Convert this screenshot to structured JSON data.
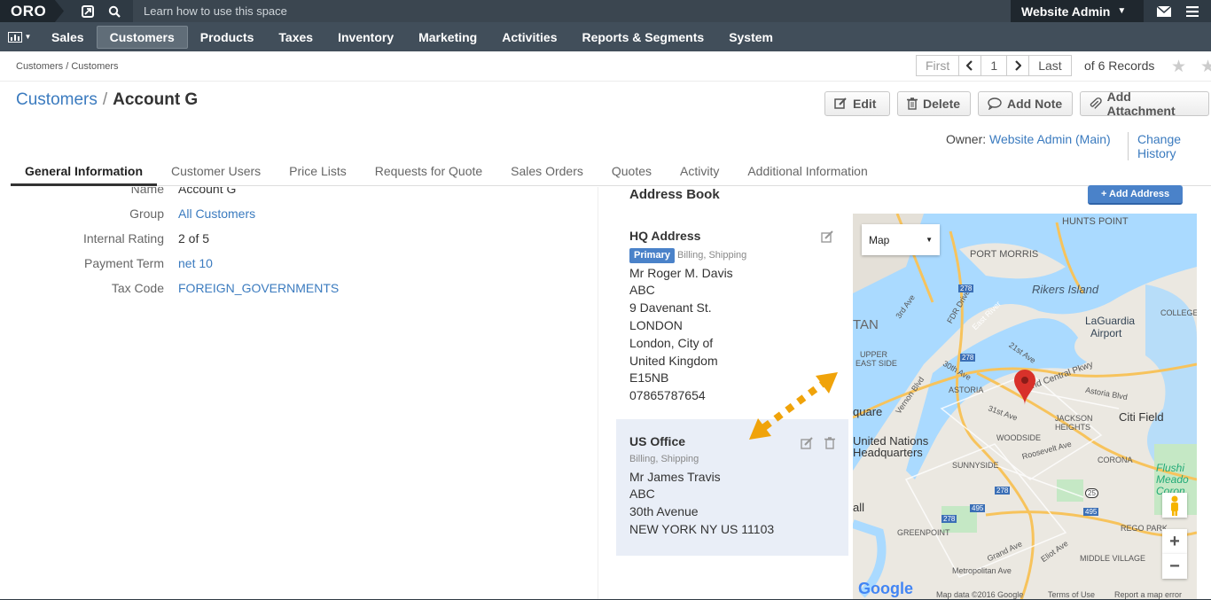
{
  "topbar": {
    "logo": "ORO",
    "search_hint": "Learn how to use this space",
    "user": "Website Admin"
  },
  "nav": [
    "Sales",
    "Customers",
    "Products",
    "Taxes",
    "Inventory",
    "Marketing",
    "Activities",
    "Reports & Segments",
    "System"
  ],
  "breadcrumb": "Customers / Customers",
  "pager": {
    "first": "First",
    "page": "1",
    "last": "Last",
    "records": "of 6 Records"
  },
  "page": {
    "section": "Customers",
    "separator": "/",
    "title": "Account G"
  },
  "actions": {
    "edit": "Edit",
    "delete": "Delete",
    "add_note": "Add Note",
    "add_attachment": "Add Attachment"
  },
  "owner": {
    "label": "Owner:",
    "value": "Website Admin (Main)",
    "change_history": "Change History"
  },
  "tabs": [
    "General Information",
    "Customer Users",
    "Price Lists",
    "Requests for Quote",
    "Sales Orders",
    "Quotes",
    "Activity",
    "Additional Information"
  ],
  "fields": [
    {
      "label": "Name",
      "value": "Account G"
    },
    {
      "label": "Group",
      "value": "All Customers"
    },
    {
      "label": "Internal Rating",
      "value": "2 of 5"
    },
    {
      "label": "Payment Term",
      "value": "net 10"
    },
    {
      "label": "Tax Code",
      "value": "FOREIGN_GOVERNMENTS"
    }
  ],
  "address_book": {
    "title": "Address Book",
    "add_button": "+ Add Address",
    "hq": {
      "title": "HQ Address",
      "primary": "Primary",
      "types": "Billing, Shipping",
      "lines": [
        "Mr Roger M. Davis",
        "ABC",
        "9 Davenant St.",
        "LONDON",
        "London, City of",
        "United Kingdom",
        "E15NB",
        "07865787654"
      ]
    },
    "us": {
      "title": "US Office",
      "types": "Billing, Shipping",
      "lines": [
        "Mr James Travis",
        "ABC",
        "30th Avenue",
        "NEW YORK NY US 11103"
      ]
    }
  },
  "map": {
    "type_select": "Map",
    "labels": {
      "hunts_point": "HUNTS POINT",
      "port_morris": "PORT MORRIS",
      "rikers": "Rikers Island",
      "laguardia1": "LaGuardia",
      "laguardia2": "Airport",
      "college": "COLLEGE",
      "tan": "TAN",
      "upper": "UPPER",
      "east_side": "EAST SIDE",
      "astoria": "ASTORIA",
      "citi_field": "Citi Field",
      "jackson1": "JACKSON",
      "jackson2": "HEIGHTS",
      "quare": "quare",
      "un1": "United Nations",
      "un2": "Headquarters",
      "woodside": "WOODSIDE",
      "sunnyside": "SUNNYSIDE",
      "corona": "CORONA",
      "flushing1": "Flushi",
      "flushing2": "Meado",
      "flushing3": "Coron",
      "all": "all",
      "greenpoint": "GREENPOINT",
      "rego_park": "REGO PARK",
      "middle_village": "MIDDLE VILLAGE",
      "fdr": "FDR Drive",
      "ave_3rd": "3rd Ave",
      "east_river": "East River",
      "st_21": "21st Ave",
      "central_pkwy": "nd Central Pkwy",
      "ave_30th": "30th Ave",
      "astoria_blvd": "Astoria Blvd",
      "vernon": "Vernon Blvd",
      "roosevelt": "Roosevelt Ave",
      "grand_ave": "Grand Ave",
      "eliot_ave": "Eliot Ave",
      "metropolitan": "Metropolitan Ave",
      "st_31": "31st Ave",
      "hwy_278": "278",
      "hwy_495": "495",
      "hwy_25": "25"
    },
    "attribution": {
      "data": "Map data ©2016 Google",
      "terms": "Terms of Use",
      "report": "Report a map error",
      "google": "Google"
    }
  },
  "colors": {
    "topbar": "#2f3a44",
    "navbar": "#414e5a",
    "link": "#3b7bbf",
    "primary": "#4a82c9",
    "annotation_arrow": "#f0a30a"
  }
}
